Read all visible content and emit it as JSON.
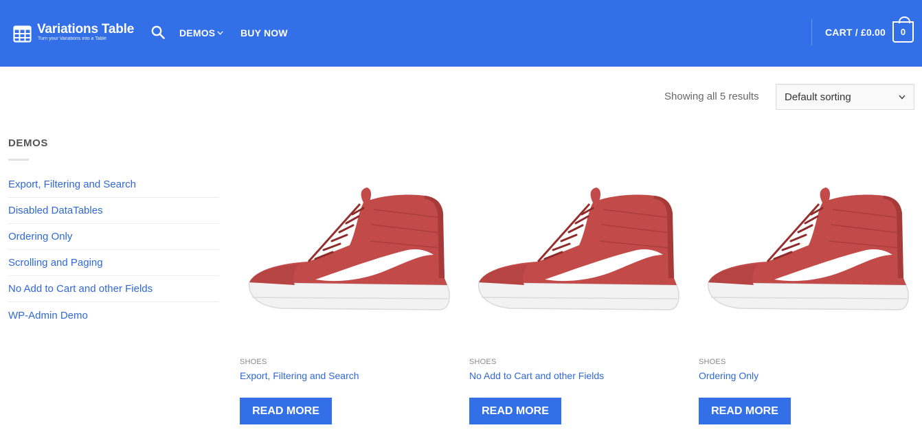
{
  "header": {
    "logo_title": "Variations Table",
    "logo_tagline": "Turn your Variations into a Table",
    "nav": {
      "demos": "DEMOS",
      "buy_now": "BUY NOW"
    },
    "cart_label": "CART / £0.00",
    "cart_count": "0",
    "icons": {
      "logo": "table-grid-icon",
      "search": "search-icon",
      "dropdown": "chevron-down-icon",
      "cart": "shopping-bag-icon"
    },
    "color": "#3370e8"
  },
  "toolbar": {
    "results_text": "Showing all 5 results",
    "sort_selected": "Default sorting"
  },
  "sidebar": {
    "title": "DEMOS",
    "items": [
      {
        "label": "Export, Filtering and Search"
      },
      {
        "label": "Disabled DataTables"
      },
      {
        "label": "Ordering Only"
      },
      {
        "label": "Scrolling and Paging"
      },
      {
        "label": "No Add to Cart and other Fields"
      },
      {
        "label": "WP-Admin Demo"
      }
    ]
  },
  "products": [
    {
      "category": "SHOES",
      "title": "Export, Filtering and Search",
      "button": "READ MORE"
    },
    {
      "category": "SHOES",
      "title": "No Add to Cart and other Fields",
      "button": "READ MORE"
    },
    {
      "category": "SHOES",
      "title": "Ordering Only",
      "button": "READ MORE"
    }
  ],
  "colors": {
    "accent": "#3370e8",
    "link": "#2f68d8",
    "shoe": "#c24a48"
  }
}
